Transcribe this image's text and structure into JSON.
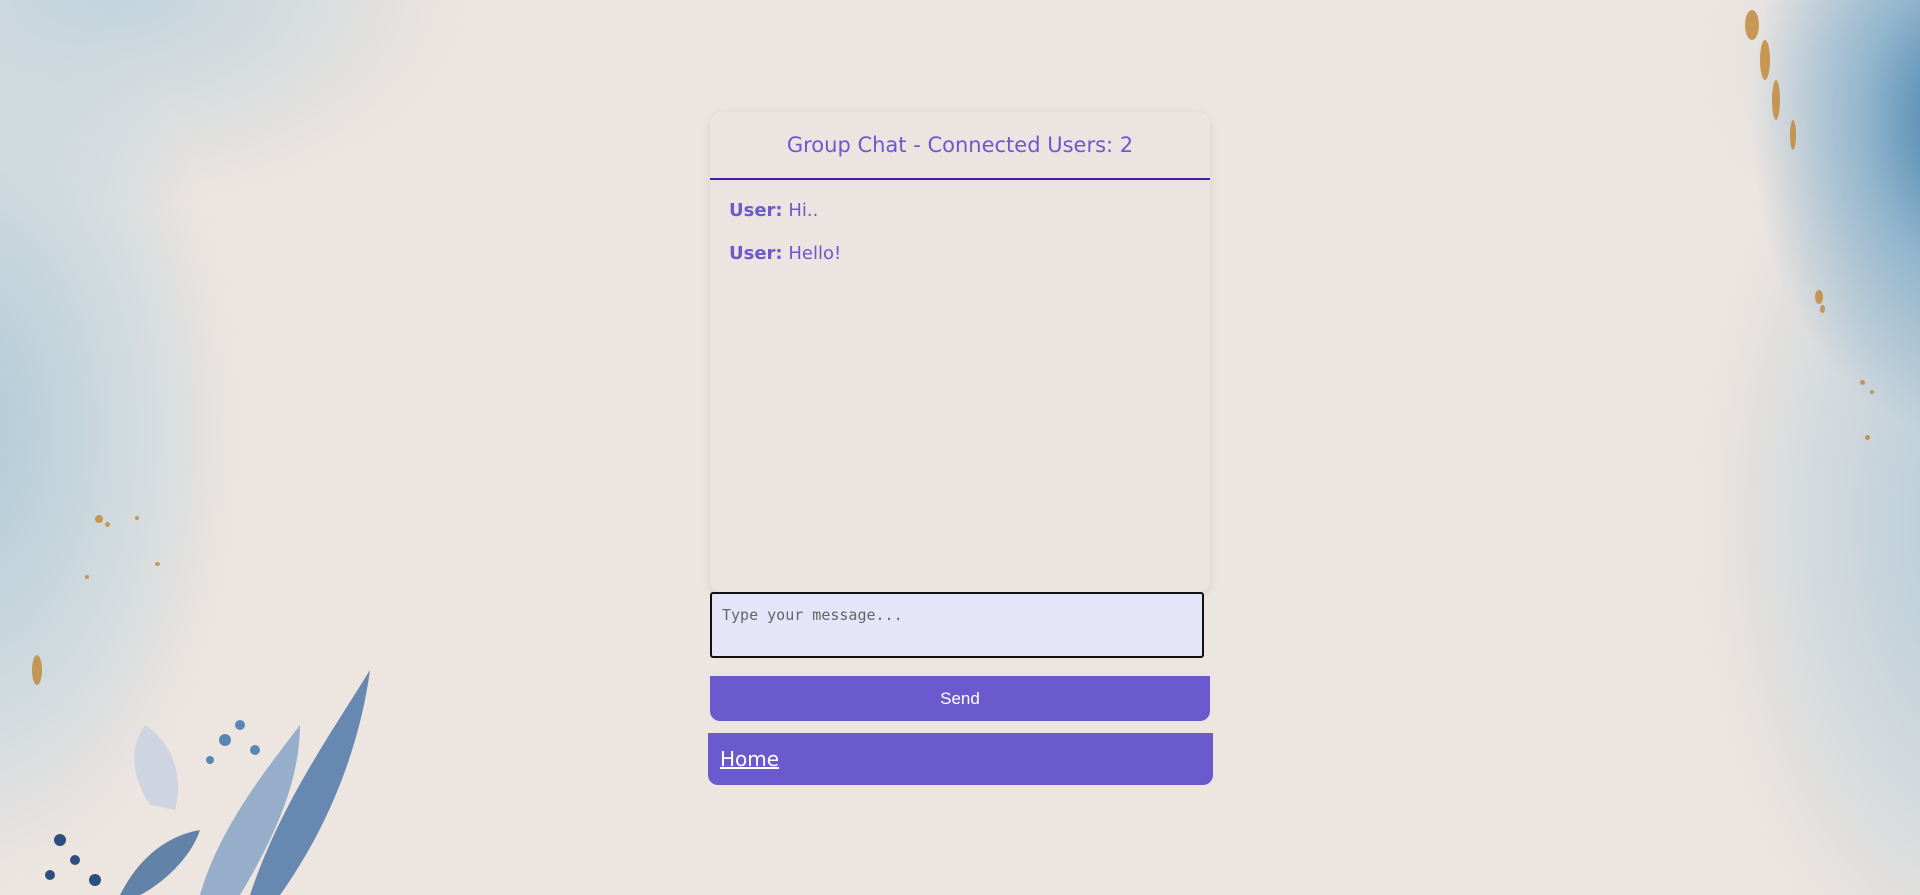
{
  "chat": {
    "title": "Group Chat - Connected Users: 2",
    "messages": [
      {
        "sender": "User:",
        "text": "Hi.."
      },
      {
        "sender": "User:",
        "text": "Hello!"
      }
    ]
  },
  "composer": {
    "placeholder": "Type your message...",
    "send_label": "Send"
  },
  "nav": {
    "home_label": "Home"
  },
  "colors": {
    "accent": "#6a5acd",
    "header_border": "#4b1f9a",
    "input_bg": "#e5e4f8",
    "background": "#ede5e0"
  }
}
